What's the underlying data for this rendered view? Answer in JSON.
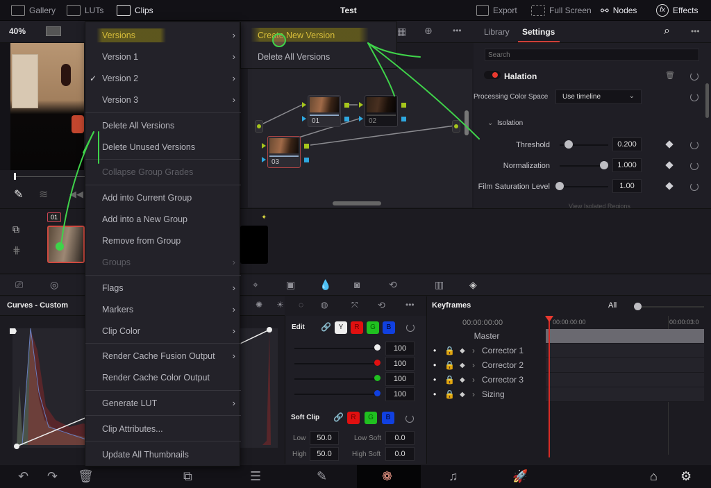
{
  "topbar": {
    "items": [
      {
        "label": "Gallery",
        "icon": "gallery-icon"
      },
      {
        "label": "LUTs",
        "icon": "luts-icon"
      },
      {
        "label": "Clips",
        "icon": "clips-icon"
      }
    ],
    "title": "Test",
    "right": [
      {
        "label": "Export",
        "icon": "export-icon"
      },
      {
        "label": "Full Screen",
        "icon": "fullscreen-icon"
      },
      {
        "label": "Nodes",
        "icon": "nodes-icon"
      },
      {
        "label": "Effects",
        "icon": "effects-icon"
      }
    ]
  },
  "viewer": {
    "zoom": "40%"
  },
  "context_menu": {
    "items": [
      {
        "label": "Versions",
        "submenu": true,
        "highlighted": true
      },
      {
        "label": "Version 1",
        "submenu": true
      },
      {
        "label": "Version 2",
        "submenu": true,
        "checked": true
      },
      {
        "label": "Version 3",
        "submenu": true
      },
      {
        "label": "Delete All Versions"
      },
      {
        "label": "Delete Unused Versions"
      },
      {
        "label": "Collapse Group Grades",
        "disabled": true
      },
      {
        "label": "Add into Current Group"
      },
      {
        "label": "Add into a New Group"
      },
      {
        "label": "Remove from Group"
      },
      {
        "label": "Groups",
        "submenu": true,
        "disabled": true
      },
      {
        "label": "Flags",
        "submenu": true
      },
      {
        "label": "Markers",
        "submenu": true
      },
      {
        "label": "Clip Color",
        "submenu": true
      },
      {
        "label": "Render Cache Fusion Output",
        "submenu": true
      },
      {
        "label": "Render Cache Color Output"
      },
      {
        "label": "Generate LUT",
        "submenu": true
      },
      {
        "label": "Clip Attributes..."
      },
      {
        "label": "Update All Thumbnails"
      }
    ],
    "check_mark": "✓",
    "chevron": "›"
  },
  "submenu": {
    "items": [
      {
        "label": "Create New Version",
        "highlighted": true
      },
      {
        "label": "Delete All Versions"
      }
    ]
  },
  "nodes": [
    {
      "label": "01"
    },
    {
      "label": "02"
    },
    {
      "label": "03"
    }
  ],
  "clip": {
    "badge": "01"
  },
  "settings": {
    "tabs": [
      {
        "label": "Library",
        "active": false
      },
      {
        "label": "Settings",
        "active": true
      }
    ],
    "search_placeholder": "Search",
    "effect_name": "Halation",
    "processing_label": "Processing Color Space",
    "processing_value": "Use timeline",
    "section": "Isolation",
    "params": [
      {
        "label": "Threshold",
        "value": "0.200",
        "fraction": 0.2
      },
      {
        "label": "Normalization",
        "value": "1.000",
        "fraction": 1.0
      },
      {
        "label": "Film Saturation Level",
        "value": "1.00",
        "fraction": 0.0
      }
    ],
    "partial_row": "View Isolated Regions"
  },
  "curves": {
    "title": "Curves - Custom"
  },
  "edit": {
    "label": "Edit",
    "channels": [
      "Y",
      "R",
      "G",
      "B"
    ],
    "values": [
      "100",
      "100",
      "100",
      "100"
    ],
    "soft_clip_label": "Soft Clip",
    "soft_clip_channels": [
      "R",
      "G",
      "B"
    ],
    "low_label": "Low",
    "low_value": "50.0",
    "high_label": "High",
    "high_value": "50.0",
    "low_soft_label": "Low Soft",
    "low_soft_value": "0.0",
    "high_soft_label": "High Soft",
    "high_soft_value": "0.0"
  },
  "keyframes": {
    "title": "Keyframes",
    "filter": "All",
    "timecode": "00:00:00:00",
    "ruler": [
      "00:00:00:00",
      "00:00:03:0"
    ],
    "rows": [
      "Master",
      "Corrector 1",
      "Corrector 2",
      "Corrector 3",
      "Sizing"
    ]
  },
  "colors": {
    "accent_red": "#e03b30",
    "highlight_yellow": "#d8be3a",
    "annotation_green": "#3fd34a",
    "node_green": "#a6c61c",
    "node_blue": "#2ea8e0"
  }
}
